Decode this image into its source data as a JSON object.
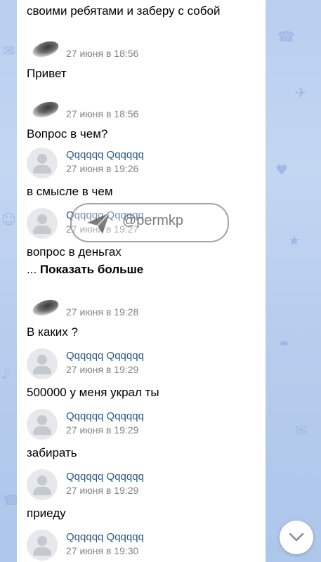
{
  "top_text": "своими ребятами и заберу с собой",
  "messages": [
    {
      "name": "",
      "time": "27 июня в 18:56",
      "text": "Привет"
    },
    {
      "name": "",
      "time": "27 июня в 18:56",
      "text": "Вопрос в чем?"
    },
    {
      "name": "Qqqqqq Qqqqqq",
      "time": "27 июня в 19:26",
      "text": "в смысле в чем"
    },
    {
      "name": "Qqqqqq Qqqqqq",
      "time": "27 июня в 19:27",
      "text": "вопрос в деньгах",
      "more_prefix": "...",
      "more_label": "Показать больше"
    },
    {
      "name": "",
      "time": "27 июня в 19:28",
      "text": "В каких ?"
    },
    {
      "name": "Qqqqqq Qqqqqq",
      "time": "27 июня в 19:29",
      "text": "500000 у меня украл ты"
    },
    {
      "name": "Qqqqqq Qqqqqq",
      "time": "27 июня в 19:29",
      "text": "забирать"
    },
    {
      "name": "Qqqqqq Qqqqqq",
      "time": "27 июня в 19:29",
      "text": "приеду"
    },
    {
      "name": "Qqqqqq Qqqqqq",
      "time": "27 июня в 19:30",
      "text": ""
    }
  ],
  "watermark": {
    "handle": "@permkp",
    "icon": "paper-plane-icon"
  },
  "scroll_button": {
    "icon": "chevron-down-icon"
  },
  "colors": {
    "name": "#2a5885",
    "time": "#828282",
    "background": "#b9cff0"
  }
}
